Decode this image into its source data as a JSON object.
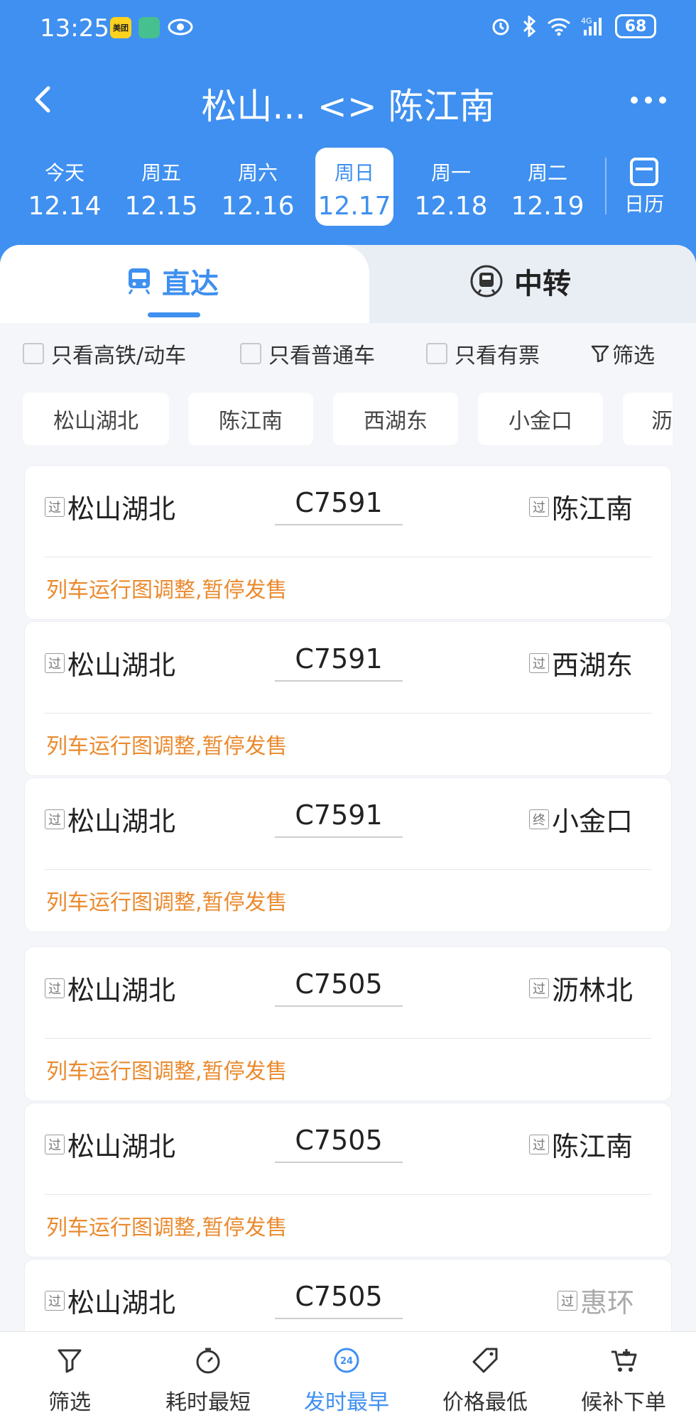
{
  "status_bar": {
    "time": "13:25",
    "app1": "美团",
    "battery": "68",
    "net": "4G"
  },
  "header": {
    "title": "松山... <> 陈江南"
  },
  "dates": [
    {
      "weekday": "今天",
      "date": "12.14"
    },
    {
      "weekday": "周五",
      "date": "12.15"
    },
    {
      "weekday": "周六",
      "date": "12.16"
    },
    {
      "weekday": "周日",
      "date": "12.17",
      "selected": true
    },
    {
      "weekday": "周一",
      "date": "12.18"
    },
    {
      "weekday": "周二",
      "date": "12.19"
    }
  ],
  "calendar_label": "日历",
  "tabs": {
    "direct": "直达",
    "transfer": "中转"
  },
  "filters": {
    "hsr": "只看高铁/动车",
    "normal": "只看普通车",
    "available": "只看有票",
    "filter": "筛选"
  },
  "station_chips": [
    "松山湖北",
    "陈江南",
    "西湖东",
    "小金口",
    "沥"
  ],
  "tag_pass": "过",
  "tag_end": "终",
  "trains": [
    {
      "from": "松山湖北",
      "no": "C7591",
      "to": "陈江南",
      "to_tag": "过",
      "msg": "列车运行图调整,暂停发售"
    },
    {
      "from": "松山湖北",
      "no": "C7591",
      "to": "西湖东",
      "to_tag": "过",
      "msg": "列车运行图调整,暂停发售"
    },
    {
      "from": "松山湖北",
      "no": "C7591",
      "to": "小金口",
      "to_tag": "终",
      "msg": "列车运行图调整,暂停发售"
    },
    {
      "from": "松山湖北",
      "no": "C7505",
      "to": "沥林北",
      "to_tag": "过",
      "msg": "列车运行图调整,暂停发售"
    },
    {
      "from": "松山湖北",
      "no": "C7505",
      "to": "陈江南",
      "to_tag": "过",
      "msg": "列车运行图调整,暂停发售"
    },
    {
      "from": "松山湖北",
      "no": "C7505",
      "to": "惠环",
      "to_tag": "过",
      "msg": ""
    }
  ],
  "bottom_nav": [
    {
      "label": "筛选",
      "icon": "filter-icon"
    },
    {
      "label": "耗时最短",
      "icon": "timer-icon"
    },
    {
      "label": "发时最早",
      "icon": "clock-24-icon",
      "active": true
    },
    {
      "label": "价格最低",
      "icon": "price-tag-icon"
    },
    {
      "label": "候补下单",
      "icon": "cart-icon"
    }
  ],
  "colors": {
    "primary": "#3f90f0",
    "warning": "#ea8a2e"
  }
}
